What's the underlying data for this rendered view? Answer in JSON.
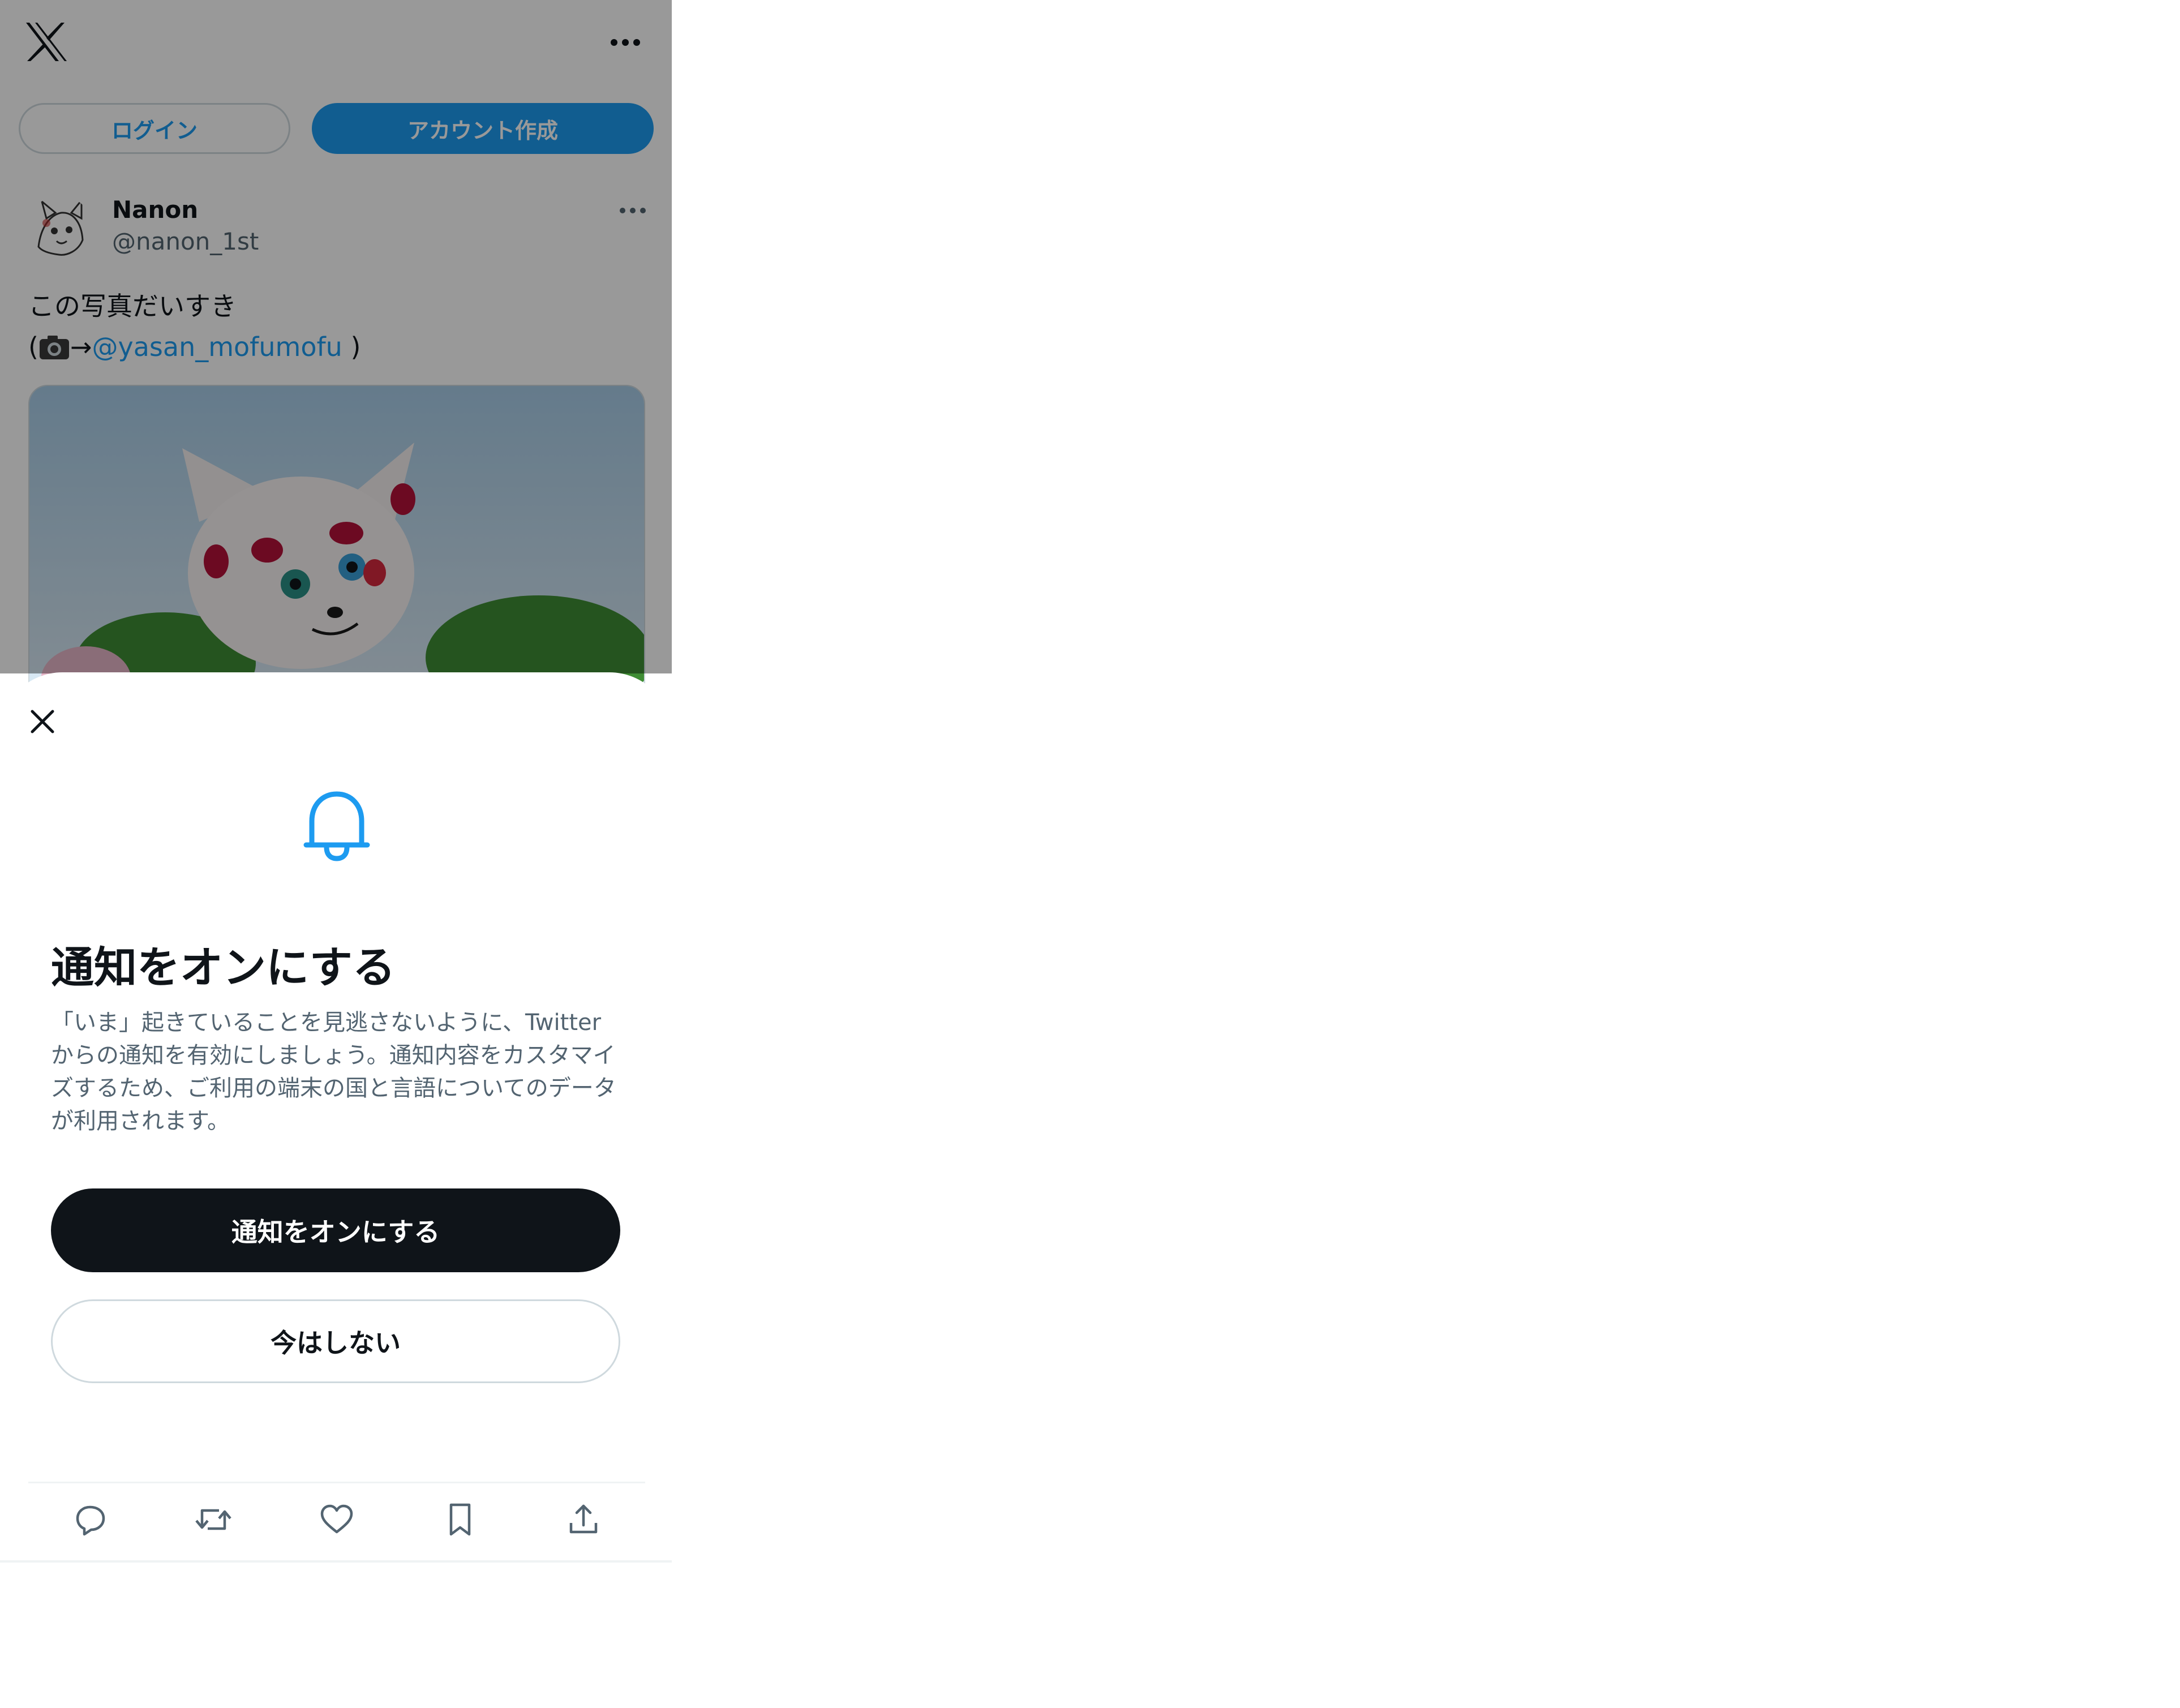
{
  "header": {
    "logo_icon": "x-logo-icon",
    "more_icon": "more-horizontal-icon"
  },
  "auth": {
    "login_label": "ログイン",
    "signup_label": "アカウント作成"
  },
  "tweet": {
    "author_name": "Nanon",
    "author_handle": "@nanon_1st",
    "text_line1": "この写真だいすき",
    "text_line2_open": "(",
    "text_line2_arrow": "→",
    "mention": "@yasan_mofumofu",
    "text_line2_close": " )"
  },
  "sheet": {
    "close_icon": "close-icon",
    "bell_icon": "bell-icon",
    "title": "通知をオンにする",
    "description": "「いま」起きていることを見逃さないように、Twitterからの通知を有効にしましょう。通知内容をカスタマイズするため、ご利用の端末の国と言語についてのデータが利用されます。",
    "primary_label": "通知をオンにする",
    "secondary_label": "今はしない"
  },
  "actions": [
    "reply-icon",
    "retweet-icon",
    "like-icon",
    "bookmark-icon",
    "share-icon"
  ],
  "colors": {
    "accent": "#1d9bf0",
    "text": "#0f1419",
    "secondary_text": "#536471",
    "border": "#cfd9de",
    "primary_button": "#0f1419"
  }
}
